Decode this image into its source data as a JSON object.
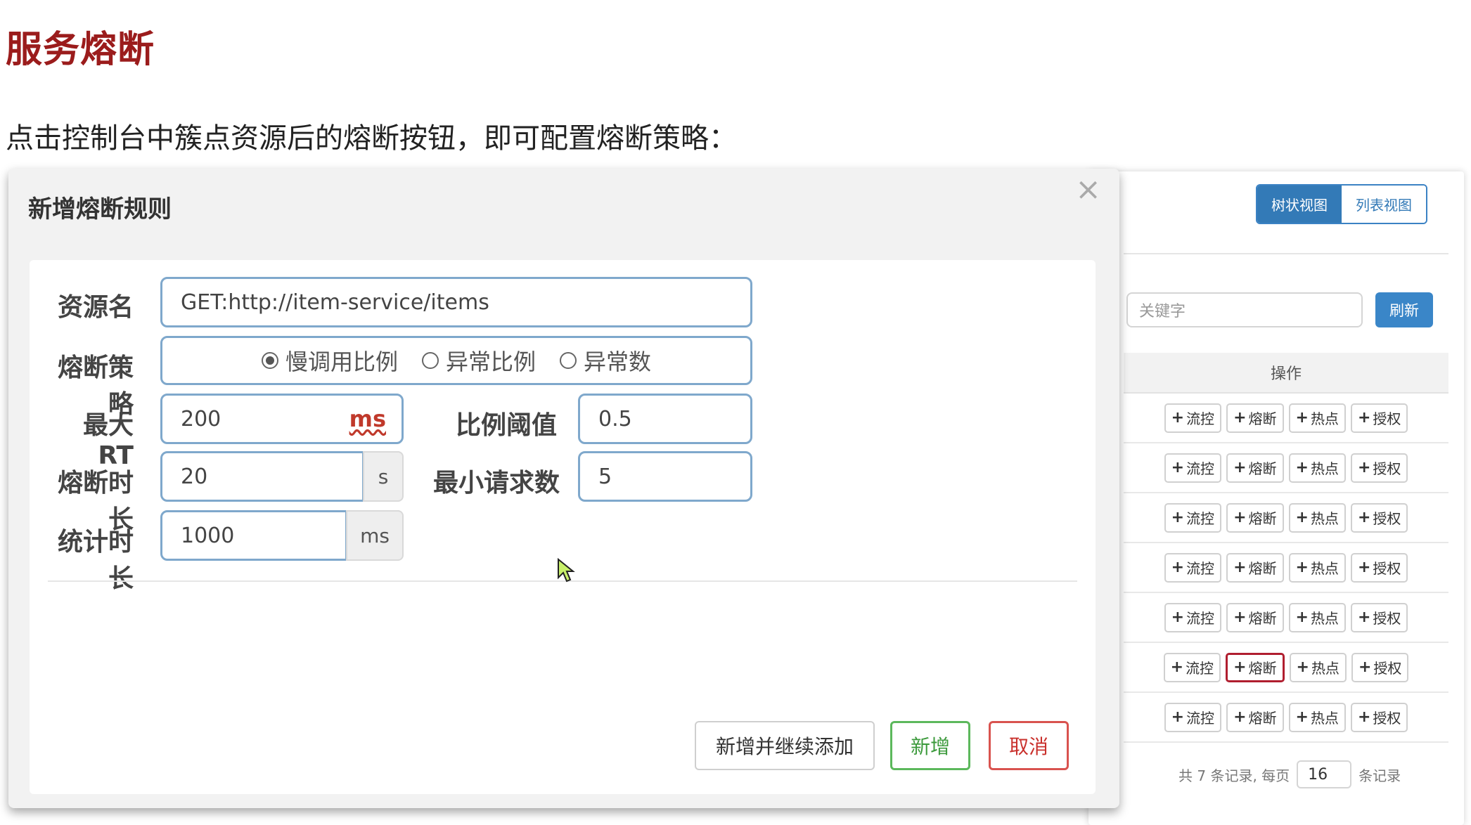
{
  "page": {
    "title": "服务熔断",
    "intro": "点击控制台中簇点资源后的熔断按钮，即可配置熔断策略："
  },
  "console": {
    "tree_view": "树状视图",
    "list_view": "列表视图",
    "keyword_placeholder": "关键字",
    "refresh": "刷新",
    "op_header": "操作",
    "row_buttons": [
      "流控",
      "熔断",
      "热点",
      "授权"
    ],
    "row_count": 7,
    "active_row": 5,
    "pager": {
      "prefix": "共 7 条记录, 每页",
      "page_size": "16",
      "suffix": "条记录"
    }
  },
  "modal": {
    "title": "新增熔断规则",
    "close": "×",
    "resource_label": "资源名",
    "resource_value": "GET:http://item-service/items",
    "strategy_label": "熔断策略",
    "strategies": [
      "慢调用比例",
      "异常比例",
      "异常数"
    ],
    "selected_strategy": 0,
    "max_rt_label": "最大 RT",
    "max_rt_value": "200",
    "max_rt_unit": "ms",
    "ratio_label": "比例阈值",
    "ratio_value": "0.5",
    "duration_label": "熔断时长",
    "duration_value": "20",
    "duration_unit": "s",
    "min_req_label": "最小请求数",
    "min_req_value": "5",
    "stat_label": "统计时长",
    "stat_value": "1000",
    "stat_unit": "ms",
    "btn_continue": "新增并继续添加",
    "btn_add": "新增",
    "btn_cancel": "取消"
  },
  "colors": {
    "title": "#9b1c1c",
    "primary": "#337ab7",
    "success": "#5cb85c",
    "danger": "#d9534f"
  }
}
